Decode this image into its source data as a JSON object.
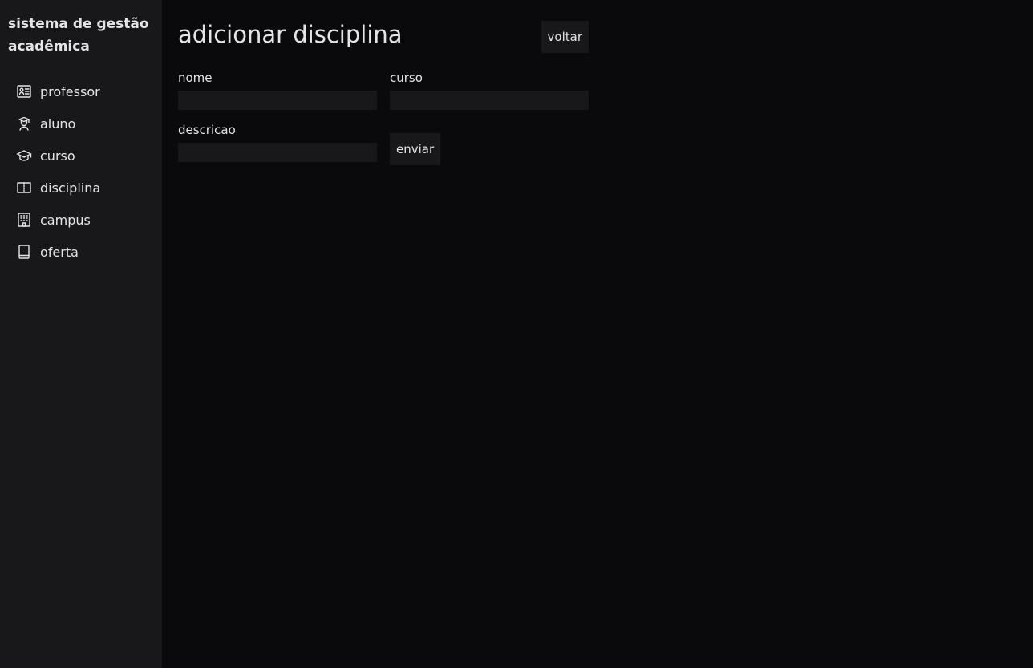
{
  "sidebar": {
    "title": "sistema de gestão acadêmica",
    "items": [
      {
        "label": "professor",
        "icon": "id-card-icon"
      },
      {
        "label": "aluno",
        "icon": "student-icon"
      },
      {
        "label": "curso",
        "icon": "graduation-cap-icon"
      },
      {
        "label": "disciplina",
        "icon": "open-book-icon"
      },
      {
        "label": "campus",
        "icon": "building-icon"
      },
      {
        "label": "oferta",
        "icon": "book-icon"
      }
    ]
  },
  "main": {
    "title": "adicionar disciplina",
    "back_label": "voltar",
    "fields": {
      "nome": {
        "label": "nome",
        "value": ""
      },
      "curso": {
        "label": "curso",
        "value": ""
      },
      "descricao": {
        "label": "descricao",
        "value": ""
      }
    },
    "submit_label": "enviar"
  },
  "colors": {
    "background": "#0a0a0c",
    "sidebar": "#18181b",
    "text": "#e4e4e7",
    "input": "#18181b"
  }
}
